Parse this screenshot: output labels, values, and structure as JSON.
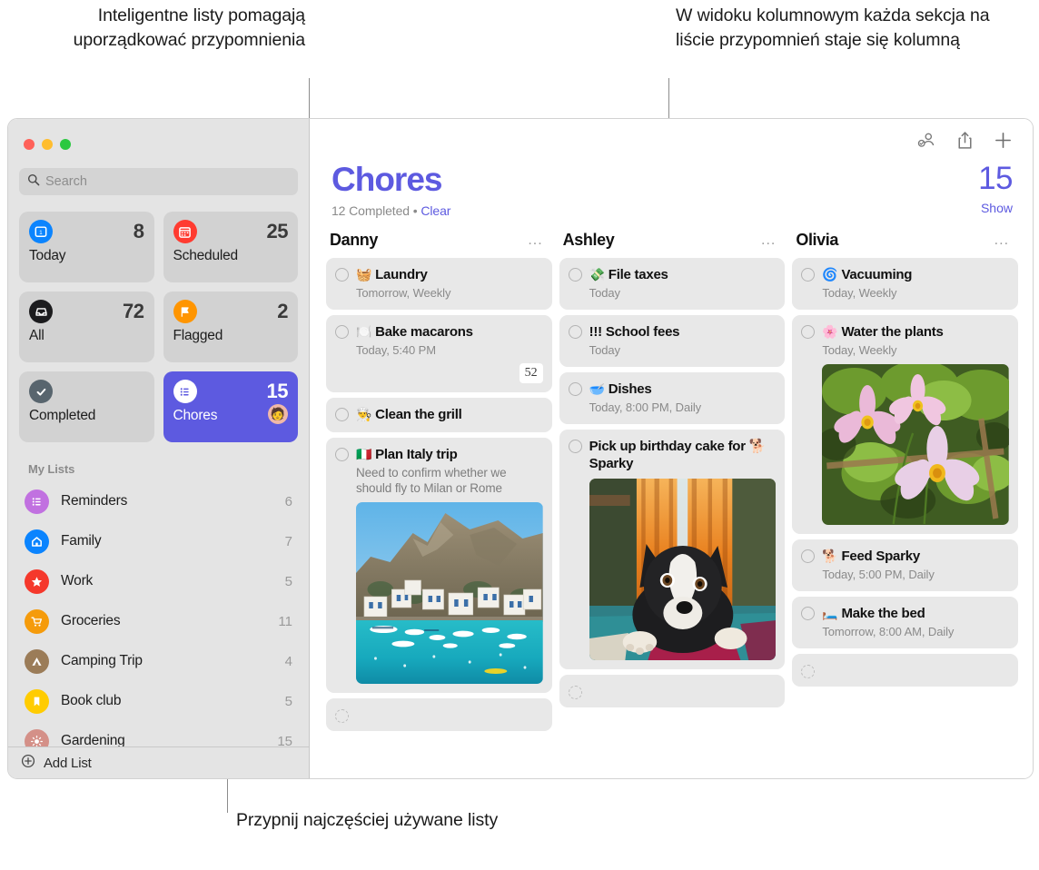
{
  "callouts": {
    "left": "Inteligentne listy pomagają uporządkować przypomnienia",
    "right": "W widoku kolumnowym każda sekcja na liście przypomnień staje się kolumną",
    "bottom": "Przypnij najczęściej używane listy"
  },
  "colors": {
    "accent": "#5d5ae0",
    "sidebar_bg": "#e4e4e4",
    "tile_bg": "#d2d2d2",
    "card_bg": "#e8e8e8"
  },
  "window": {
    "traffic_lights": [
      "close",
      "minimize",
      "zoom"
    ]
  },
  "search": {
    "placeholder": "Search",
    "value": "",
    "icon": "search-icon"
  },
  "smart_lists": [
    {
      "label": "Today",
      "count": "8",
      "icon": "today-calendar-icon",
      "icon_bg": "#0b84fe",
      "selected": false
    },
    {
      "label": "Scheduled",
      "count": "25",
      "icon": "calendar-icon",
      "icon_bg": "#ff3b30",
      "selected": false
    },
    {
      "label": "All",
      "count": "72",
      "icon": "inbox-tray-icon",
      "icon_bg": "#1c1c1e",
      "selected": false
    },
    {
      "label": "Flagged",
      "count": "2",
      "icon": "flag-icon",
      "icon_bg": "#ff9500",
      "selected": false
    },
    {
      "label": "Completed",
      "count": "",
      "icon": "checkmark-icon",
      "icon_bg": "#58656e",
      "selected": false
    },
    {
      "label": "Chores",
      "count": "15",
      "icon": "list-bullet-icon",
      "icon_bg": "#ffffff",
      "selected": true,
      "avatar": "shared-avatar"
    }
  ],
  "my_lists": {
    "header": "My Lists",
    "items": [
      {
        "label": "Reminders",
        "count": "6",
        "icon": "list-bullet-icon",
        "icon_bg": "#c171e0"
      },
      {
        "label": "Family",
        "count": "7",
        "icon": "house-icon",
        "icon_bg": "#0b84fe"
      },
      {
        "label": "Work",
        "count": "5",
        "icon": "star-icon",
        "icon_bg": "#f5382b"
      },
      {
        "label": "Groceries",
        "count": "11",
        "icon": "cart-icon",
        "icon_bg": "#f59b0b"
      },
      {
        "label": "Camping Trip",
        "count": "4",
        "icon": "tent-icon",
        "icon_bg": "#9b7c58"
      },
      {
        "label": "Book club",
        "count": "5",
        "icon": "bookmark-icon",
        "icon_bg": "#ffcc00"
      },
      {
        "label": "Gardening",
        "count": "15",
        "icon": "sun-icon",
        "icon_bg": "#d49088"
      }
    ],
    "add_list_label": "Add List"
  },
  "toolbar": {
    "share_people_icon": "person-badge-checkmark-icon",
    "share_icon": "share-up-arrow-icon",
    "add_icon": "plus-icon"
  },
  "header": {
    "title": "Chores",
    "completed_text": "12 Completed",
    "separator": "•",
    "clear_label": "Clear",
    "count": "15",
    "show_label": "Show"
  },
  "columns": [
    {
      "name": "Danny",
      "more": "...",
      "items": [
        {
          "emoji": "🧺",
          "title": "Laundry",
          "sub": "Tomorrow, Weekly"
        },
        {
          "emoji": "🍽️",
          "title": "Bake macarons",
          "sub": "Today, 5:40 PM",
          "badge": "52"
        },
        {
          "emoji": "👨‍🍳",
          "title": "Clean the grill",
          "sub": ""
        },
        {
          "emoji": "🇮🇹",
          "title": "Plan Italy trip",
          "note": "Need to confirm whether we should fly to Milan or Rome",
          "photo": "italy-coast-photo"
        },
        {
          "emoji": "",
          "title": "",
          "sub": "",
          "empty": true
        }
      ]
    },
    {
      "name": "Ashley",
      "more": "...",
      "items": [
        {
          "emoji": "💸",
          "title": "File taxes",
          "sub": "Today"
        },
        {
          "emoji": "",
          "title": "!!! School fees",
          "sub": "Today"
        },
        {
          "emoji": "🥣",
          "title": "Dishes",
          "sub": "Today, 8:00 PM, Daily"
        },
        {
          "emoji": "🐕",
          "title": "Pick up birthday cake for 🐕 Sparky",
          "photo": "boston-terrier-photo"
        },
        {
          "emoji": "",
          "title": "",
          "sub": "",
          "empty": true
        }
      ]
    },
    {
      "name": "Olivia",
      "more": "...",
      "items": [
        {
          "emoji": "🌀",
          "title": "Vacuuming",
          "sub": "Today, Weekly"
        },
        {
          "emoji": "🌸",
          "title": "Water the plants",
          "sub": "Today, Weekly",
          "photo": "cosmos-flowers-photo"
        },
        {
          "emoji": "🐕",
          "title": "Feed Sparky",
          "sub": "Today, 5:00 PM, Daily"
        },
        {
          "emoji": "🛏️",
          "title": "Make the bed",
          "sub": "Tomorrow, 8:00 AM, Daily"
        },
        {
          "emoji": "",
          "title": "",
          "sub": "",
          "empty": true
        }
      ]
    }
  ]
}
